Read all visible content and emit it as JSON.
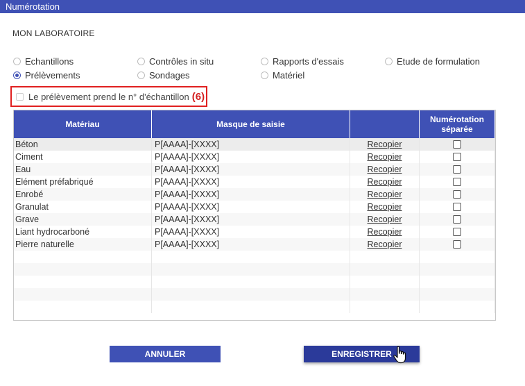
{
  "window": {
    "title": "Numérotation"
  },
  "section": {
    "title": "MON LABORATOIRE"
  },
  "radios": [
    {
      "label": "Echantillons",
      "checked": false
    },
    {
      "label": "Contrôles in situ",
      "checked": false
    },
    {
      "label": "Rapports d'essais",
      "checked": false
    },
    {
      "label": "Etude de formulation",
      "checked": false
    },
    {
      "label": "Prélèvements",
      "checked": true
    },
    {
      "label": "Sondages",
      "checked": false
    },
    {
      "label": "Matériel",
      "checked": false
    }
  ],
  "option": {
    "label": "Le prélèvement prend le n° d'échantillon",
    "number": "(6)",
    "checked": false
  },
  "table": {
    "headers": {
      "material": "Matériau",
      "mask": "Masque de saisie",
      "action": "",
      "separate": "Numérotation séparée"
    },
    "rows": [
      {
        "material": "Béton",
        "mask": "P[AAAA]-[XXXX]",
        "action": "Recopier",
        "separate": false
      },
      {
        "material": "Ciment",
        "mask": "P[AAAA]-[XXXX]",
        "action": "Recopier",
        "separate": false
      },
      {
        "material": "Eau",
        "mask": "P[AAAA]-[XXXX]",
        "action": "Recopier",
        "separate": false
      },
      {
        "material": "Elément préfabriqué",
        "mask": "P[AAAA]-[XXXX]",
        "action": "Recopier",
        "separate": false
      },
      {
        "material": "Enrobé",
        "mask": "P[AAAA]-[XXXX]",
        "action": "Recopier",
        "separate": false
      },
      {
        "material": "Granulat",
        "mask": "P[AAAA]-[XXXX]",
        "action": "Recopier",
        "separate": false
      },
      {
        "material": "Grave",
        "mask": "P[AAAA]-[XXXX]",
        "action": "Recopier",
        "separate": false
      },
      {
        "material": "Liant hydrocarboné",
        "mask": "P[AAAA]-[XXXX]",
        "action": "Recopier",
        "separate": false
      },
      {
        "material": "Pierre naturelle",
        "mask": "P[AAAA]-[XXXX]",
        "action": "Recopier",
        "separate": false
      }
    ]
  },
  "buttons": {
    "cancel": "ANNULER",
    "save": "ENREGISTRER"
  },
  "colors": {
    "primary": "#3f51b5",
    "primary_dark": "#2b3a9a",
    "highlight": "#e02020"
  },
  "icons": {
    "cursor": "hand-pointer-icon"
  }
}
